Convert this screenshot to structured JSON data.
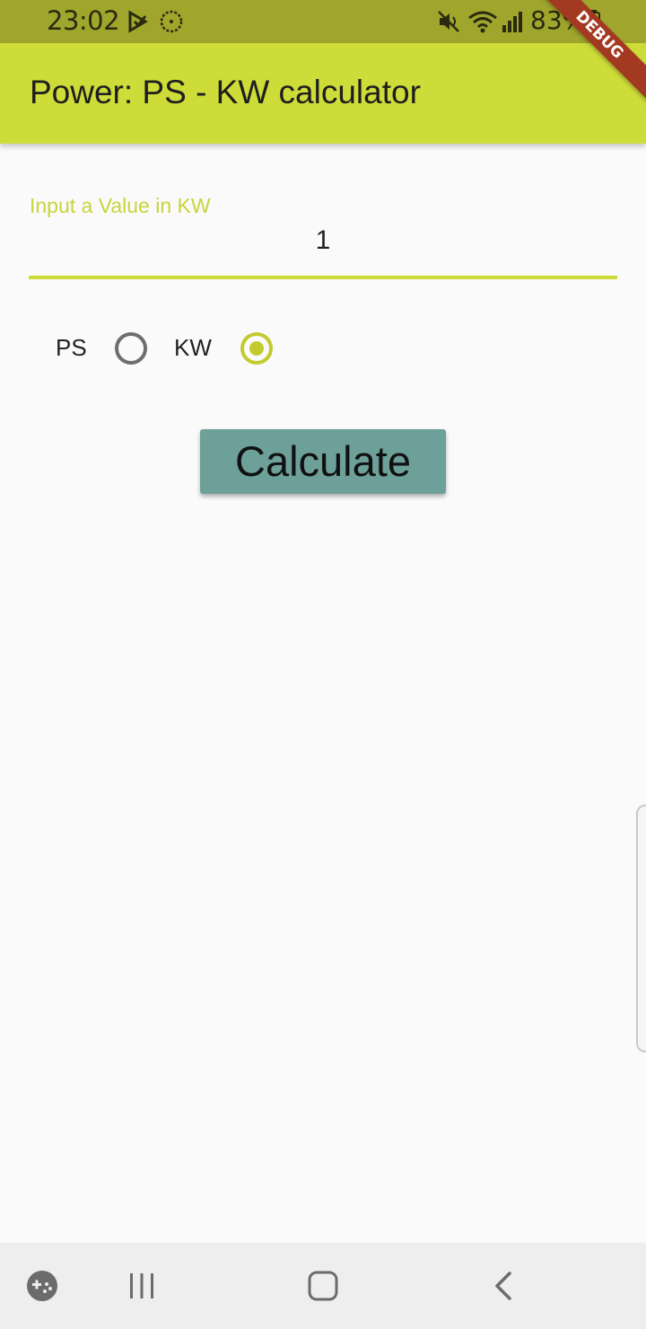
{
  "status_bar": {
    "time": "23:02",
    "battery": "83%",
    "icons": [
      "play-store-download-icon",
      "sync-icon",
      "mute-icon",
      "wifi-icon",
      "signal-icon",
      "battery-icon"
    ]
  },
  "debug_banner": "DEBUG",
  "app_bar": {
    "title": "Power: PS - KW calculator"
  },
  "input": {
    "label": "Input a Value in KW",
    "value": "1"
  },
  "radio_group": {
    "options": [
      {
        "label": "PS",
        "selected": false
      },
      {
        "label": "KW",
        "selected": true
      }
    ]
  },
  "calculate_button": {
    "label": "Calculate"
  },
  "nav_bar": {
    "icons": [
      "game-launcher-icon",
      "recent-apps-icon",
      "home-icon",
      "back-icon"
    ]
  },
  "colors": {
    "accent": "#cddc39",
    "status_bar": "#a0a62c",
    "button": "#6ea09a",
    "debug_banner": "#a33920"
  }
}
